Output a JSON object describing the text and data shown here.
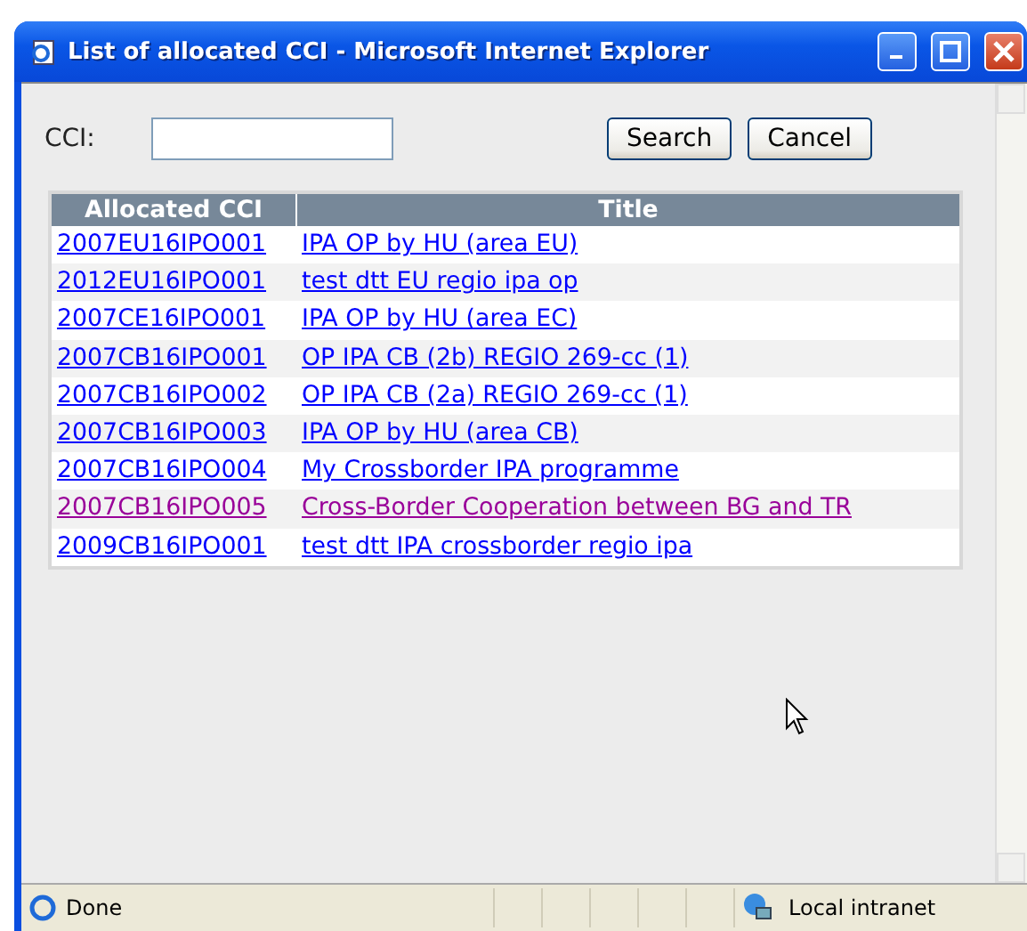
{
  "window": {
    "title": "List of allocated CCI - Microsoft Internet Explorer"
  },
  "search_form": {
    "label": "CCI:",
    "buttons": [
      "Search",
      "Cancel"
    ]
  },
  "table": {
    "columns": [
      "Allocated CCI",
      "Title"
    ],
    "rows": [
      {
        "cci": "2007EU16IPO001",
        "title": "IPA OP by HU (area EU)",
        "visited": false
      },
      {
        "cci": "2012EU16IPO001",
        "title": "test dtt EU regio ipa op",
        "visited": false
      },
      {
        "cci": "2007CE16IPO001",
        "title": "IPA OP by HU (area EC)",
        "visited": false
      },
      {
        "cci": "2007CB16IPO001",
        "title": "OP IPA CB (2b) REGIO 269-cc (1)",
        "visited": false
      },
      {
        "cci": "2007CB16IPO002",
        "title": "OP IPA CB (2a) REGIO 269-cc (1)",
        "visited": false
      },
      {
        "cci": "2007CB16IPO003",
        "title": "IPA OP by HU (area CB)",
        "visited": false
      },
      {
        "cci": "2007CB16IPO004",
        "title": "My Crossborder IPA programme",
        "visited": false
      },
      {
        "cci": "2007CB16IPO005",
        "title": "Cross-Border Cooperation between BG and TR",
        "visited": true
      },
      {
        "cci": "2009CB16IPO001",
        "title": "test dtt IPA crossborder regio ipa",
        "visited": false
      }
    ]
  },
  "status_bar": {
    "status": "Done",
    "zone": "Local intranet"
  }
}
